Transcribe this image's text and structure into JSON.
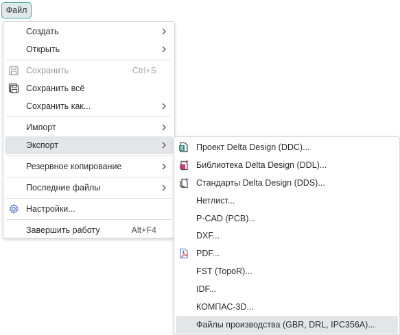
{
  "menubar": {
    "file_label": "Файл"
  },
  "main_menu": {
    "create": "Создать",
    "open": "Открыть",
    "save": "Сохранить",
    "save_shortcut": "Ctrl+S",
    "save_all": "Сохранить всё",
    "save_as": "Сохранить как...",
    "import": "Импорт",
    "export": "Экспорт",
    "backup": "Резервное копирование",
    "recent": "Последние файлы",
    "settings": "Настройки...",
    "exit": "Завершить работу",
    "exit_shortcut": "Alt+F4"
  },
  "export_submenu": {
    "ddc": "Проект Delta Design (DDC)...",
    "ddl": "Библиотека Delta Design (DDL)...",
    "dds": "Стандарты Delta Design (DDS)...",
    "netlist": "Нетлист...",
    "pcad": "P-CAD (PCB)...",
    "dxf": "DXF...",
    "pdf": "PDF...",
    "fst": "FST (TopoR)...",
    "idf": "IDF...",
    "kompas": "КОМПАС-3D...",
    "production": "Файлы производства (GBR, DRL, IPC356A)..."
  },
  "colors": {
    "accent": "#3aa7a2",
    "highlight": "#e3e6e8",
    "icon_teal": "#2f8f8a",
    "icon_pink": "#c8407a",
    "icon_blue": "#5b7fd6"
  }
}
